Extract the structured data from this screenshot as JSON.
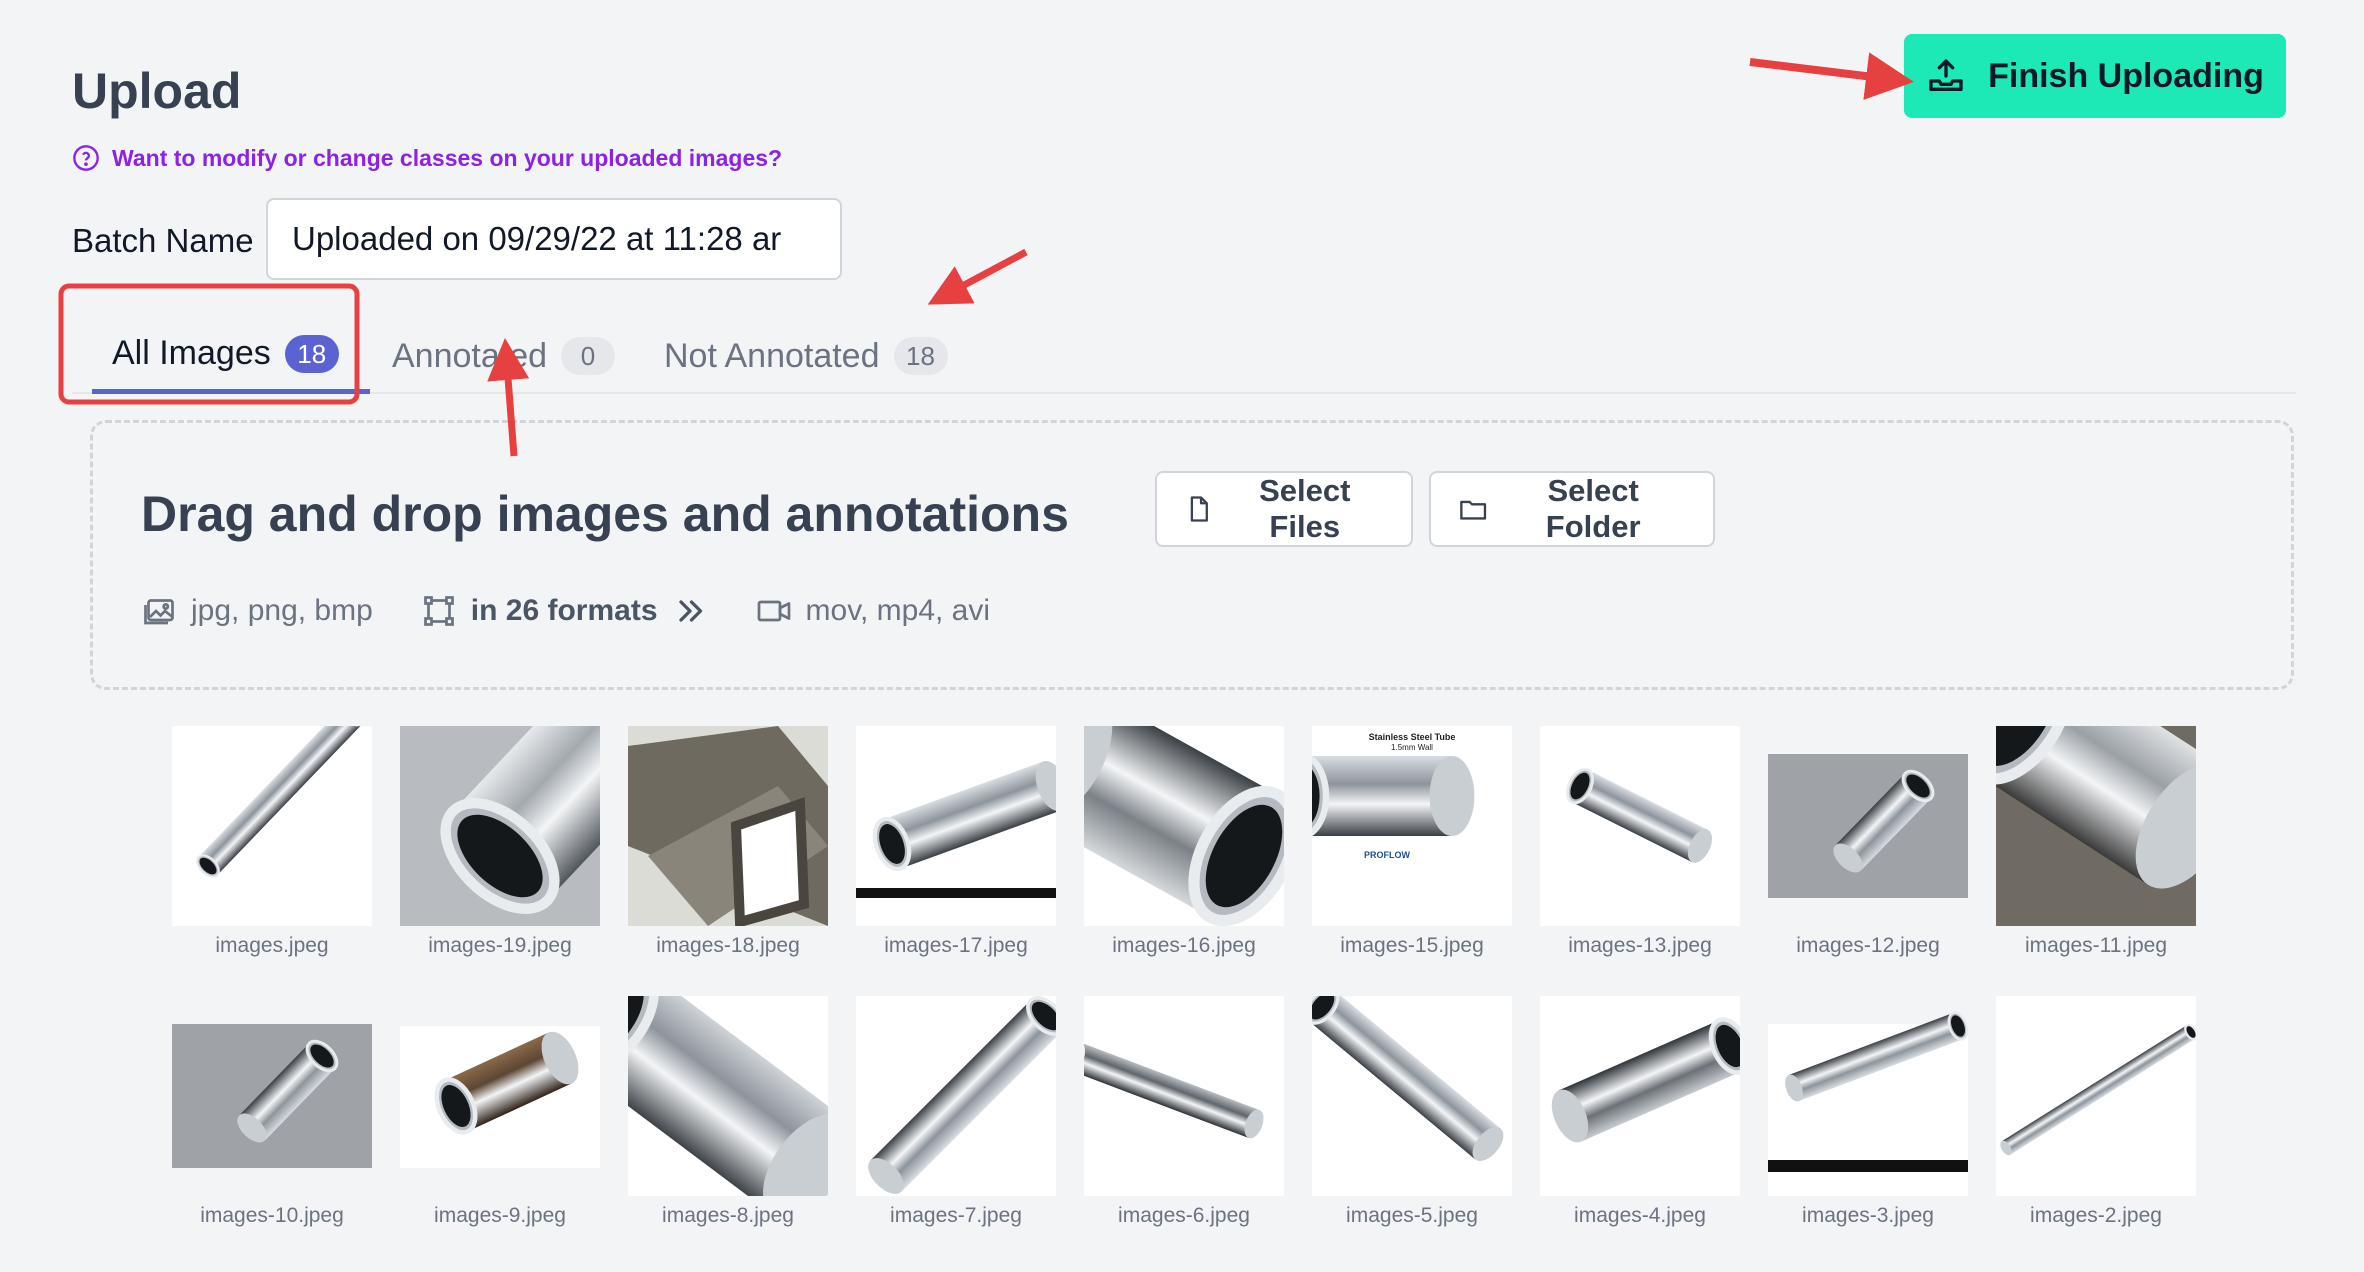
{
  "header": {
    "title": "Upload",
    "help_link": "Want to modify or change classes on your uploaded images?",
    "finish_button": "Finish Uploading"
  },
  "batch": {
    "label": "Batch Name",
    "value": "Uploaded on 09/29/22 at 11:28 ar"
  },
  "tabs": [
    {
      "label": "All Images",
      "count": "18",
      "active": true
    },
    {
      "label": "Annotated",
      "count": "0",
      "active": false
    },
    {
      "label": "Not Annotated",
      "count": "18",
      "active": false
    }
  ],
  "dropzone": {
    "title": "Drag and drop images and annotations",
    "image_formats": "jpg, png, bmp",
    "annotation_formats": "in 26 formats",
    "video_formats": "mov, mp4, avi",
    "select_files": "Select Files",
    "select_folder": "Select Folder"
  },
  "images": [
    {
      "name": "images.jpeg",
      "kind": "thin-diagonal"
    },
    {
      "name": "images-19.jpeg",
      "kind": "big-shiny"
    },
    {
      "name": "images-18.jpeg",
      "kind": "square"
    },
    {
      "name": "images-17.jpeg",
      "kind": "oval"
    },
    {
      "name": "images-16.jpeg",
      "kind": "big-gray"
    },
    {
      "name": "images-15.jpeg",
      "kind": "labeled",
      "caption": "Stainless Steel Tube",
      "caption2": "1.5mm Wall",
      "brand": "PROFLOW"
    },
    {
      "name": "images-13.jpeg",
      "kind": "short-diagonal"
    },
    {
      "name": "images-12.jpeg",
      "kind": "gray-bg"
    },
    {
      "name": "images-11.jpeg",
      "kind": "close-up"
    },
    {
      "name": "images-10.jpeg",
      "kind": "gray-bg"
    },
    {
      "name": "images-9.jpeg",
      "kind": "rusty"
    },
    {
      "name": "images-8.jpeg",
      "kind": "slotted"
    },
    {
      "name": "images-7.jpeg",
      "kind": "long-diagonal"
    },
    {
      "name": "images-6.jpeg",
      "kind": "thin-right"
    },
    {
      "name": "images-5.jpeg",
      "kind": "long-right"
    },
    {
      "name": "images-4.jpeg",
      "kind": "medium"
    },
    {
      "name": "images-3.jpeg",
      "kind": "banded"
    },
    {
      "name": "images-2.jpeg",
      "kind": "very-thin"
    }
  ],
  "colors": {
    "accent": "#1de9b6",
    "tab_active": "#5b63d3",
    "link": "#8b22e6",
    "annotation_red": "#e74040"
  }
}
